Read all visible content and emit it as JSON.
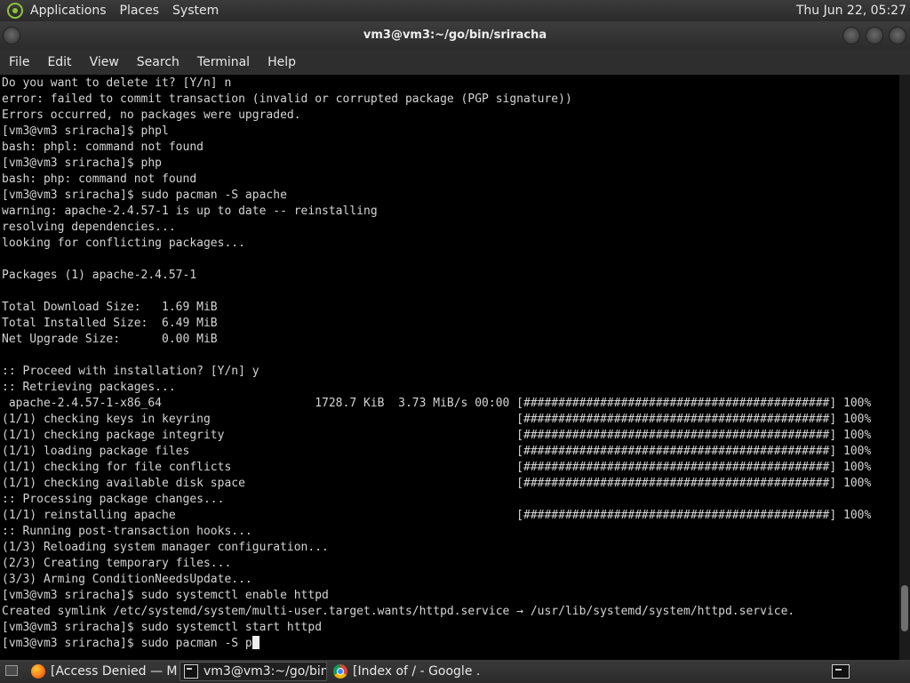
{
  "top_panel": {
    "logo_icon": "distro-logo-icon",
    "menus": [
      "Applications",
      "Places",
      "System"
    ],
    "clock": "Thu Jun 22, 05:27"
  },
  "window": {
    "title": "vm3@vm3:~/go/bin/sriracha",
    "menu": [
      "File",
      "Edit",
      "View",
      "Search",
      "Terminal",
      "Help"
    ]
  },
  "terminal": {
    "lines": [
      "Do you want to delete it? [Y/n] n",
      "error: failed to commit transaction (invalid or corrupted package (PGP signature))",
      "Errors occurred, no packages were upgraded.",
      "[vm3@vm3 sriracha]$ phpl",
      "bash: phpl: command not found",
      "[vm3@vm3 sriracha]$ php",
      "bash: php: command not found",
      "[vm3@vm3 sriracha]$ sudo pacman -S apache",
      "warning: apache-2.4.57-1 is up to date -- reinstalling",
      "resolving dependencies...",
      "looking for conflicting packages...",
      "",
      "Packages (1) apache-2.4.57-1",
      "",
      "Total Download Size:   1.69 MiB",
      "Total Installed Size:  6.49 MiB",
      "Net Upgrade Size:      0.00 MiB",
      "",
      ":: Proceed with installation? [Y/n] y",
      ":: Retrieving packages...",
      " apache-2.4.57-1-x86_64                      1728.7 KiB  3.73 MiB/s 00:00 [############################################] 100%",
      "(1/1) checking keys in keyring                                            [############################################] 100%",
      "(1/1) checking package integrity                                          [############################################] 100%",
      "(1/1) loading package files                                               [############################################] 100%",
      "(1/1) checking for file conflicts                                         [############################################] 100%",
      "(1/1) checking available disk space                                       [############################################] 100%",
      ":: Processing package changes...",
      "(1/1) reinstalling apache                                                 [############################################] 100%",
      ":: Running post-transaction hooks...",
      "(1/3) Reloading system manager configuration...",
      "(2/3) Creating temporary files...",
      "(3/3) Arming ConditionNeedsUpdate...",
      "[vm3@vm3 sriracha]$ sudo systemctl enable httpd",
      "Created symlink /etc/systemd/system/multi-user.target.wants/httpd.service → /usr/lib/systemd/system/httpd.service.",
      "[vm3@vm3 sriracha]$ sudo systemctl start httpd"
    ],
    "current_prompt": "[vm3@vm3 sriracha]$ sudo pacman -S p",
    "scroll_position": 0.95
  },
  "taskbar": {
    "show_desktop_icon": "show-desktop-icon",
    "tasks": [
      {
        "label": "[Access Denied — M...",
        "icon": "firefox-icon",
        "active": false
      },
      {
        "label": "vm3@vm3:~/go/bin...",
        "icon": "terminal-icon",
        "active": true
      },
      {
        "label": "[Index of / - Google ...",
        "icon": "chrome-icon",
        "active": false
      }
    ],
    "tray_icon": "terminal-icon"
  }
}
